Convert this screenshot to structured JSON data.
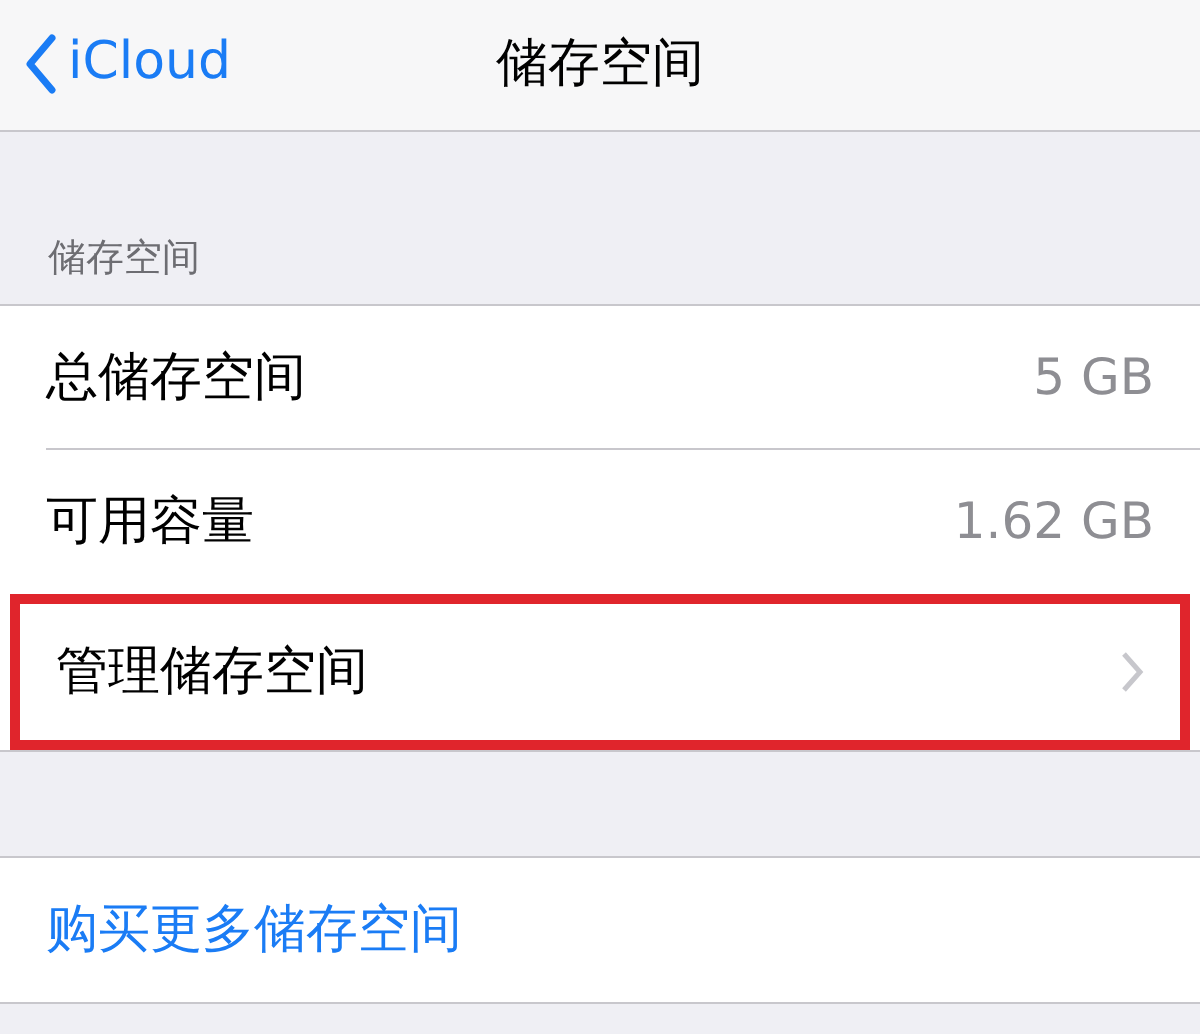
{
  "nav": {
    "back": "iCloud",
    "title": "储存空间"
  },
  "section_header": "储存空间",
  "rows": [
    {
      "kind": "value",
      "label": "总储存空间",
      "value": "5 GB",
      "highlighted": false
    },
    {
      "kind": "value",
      "label": "可用容量",
      "value": "1.62 GB",
      "highlighted": false
    },
    {
      "kind": "link",
      "label": "管理储存空间",
      "highlighted": true
    }
  ],
  "action": "购买更多储存空间"
}
